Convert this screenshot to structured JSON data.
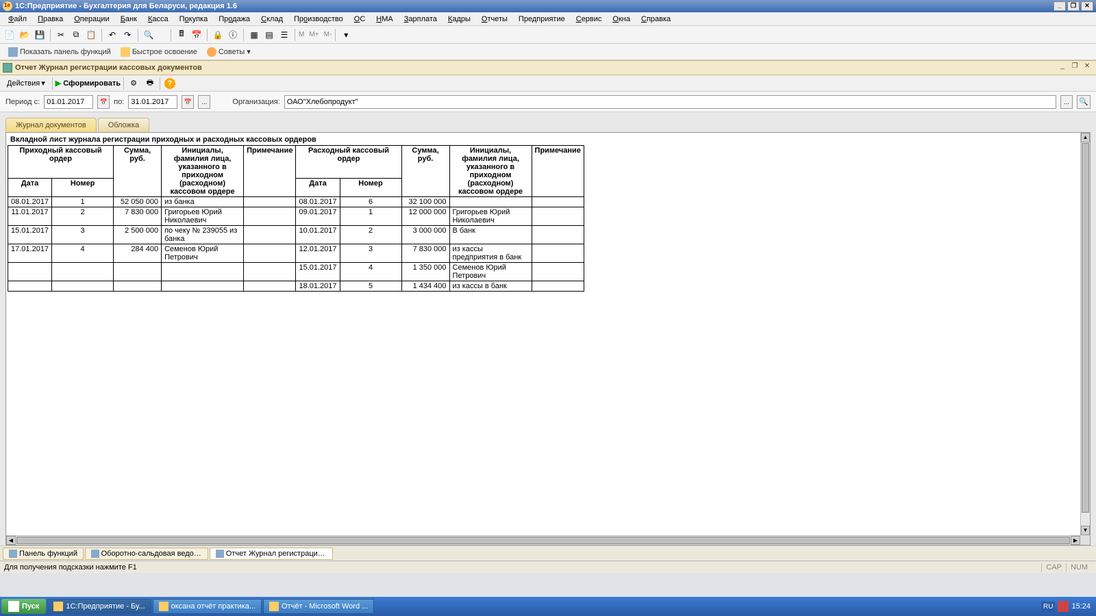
{
  "titlebar": {
    "title": "1С:Предприятие - Бухгалтерия для Беларуси, редакция 1.6"
  },
  "menu": [
    "Файл",
    "Правка",
    "Операции",
    "Банк",
    "Касса",
    "Покупка",
    "Продажа",
    "Склад",
    "Производство",
    "ОС",
    "НМА",
    "Зарплата",
    "Кадры",
    "Отчеты",
    "Предприятие",
    "Сервис",
    "Окна",
    "Справка"
  ],
  "menu_underline_idx": [
    0,
    0,
    0,
    0,
    0,
    1,
    2,
    0,
    2,
    0,
    0,
    0,
    0,
    0,
    3,
    0,
    0,
    0
  ],
  "toolbar_m": [
    "М",
    "М+",
    "М-"
  ],
  "toolbar2": {
    "panel": "Показать панель функций",
    "quick": "Быстрое освоение",
    "tips": "Советы"
  },
  "doc": {
    "title": "Отчет Журнал регистрации кассовых документов"
  },
  "actions": {
    "actions": "Действия",
    "generate": "Сформировать"
  },
  "filter": {
    "period_label": "Период с:",
    "from": "01.01.2017",
    "to_label": "по:",
    "to": "31.01.2017",
    "org_label": "Организация:",
    "org": "ОАО\"Хлебопродукт\""
  },
  "tabs": [
    "Журнал документов",
    "Обложка"
  ],
  "report": {
    "title": "Вкладной лист журнала регистрации приходных и расходных кассовых ордеров",
    "headers": {
      "pko": "Приходный кассовый ордер",
      "rko": "Расходный кассовый ордер",
      "date": "Дата",
      "num": "Номер",
      "sum": "Сумма, руб.",
      "person": "Инициалы, фамилия лица, указанного в приходном (расходном) кассовом ордере",
      "note": "Примечание"
    },
    "rows": [
      {
        "pd": "08.01.2017",
        "pn": "1",
        "ps": "52 050 000",
        "pp": "из банка",
        "pnote": "",
        "rd": "08.01.2017",
        "rn": "6",
        "rs": "32 100 000",
        "rp": "",
        "rnote": ""
      },
      {
        "pd": "11.01.2017",
        "pn": "2",
        "ps": "7 830 000",
        "pp": "Григорьев Юрий Николаевич",
        "pnote": "",
        "rd": "09.01.2017",
        "rn": "1",
        "rs": "12 000 000",
        "rp": "Григорьев Юрий Николаевич",
        "rnote": ""
      },
      {
        "pd": "15.01.2017",
        "pn": "3",
        "ps": "2 500 000",
        "pp": "по чеку № 239055 из банка",
        "pnote": "",
        "rd": "10.01.2017",
        "rn": "2",
        "rs": "3 000 000",
        "rp": "В банк",
        "rnote": ""
      },
      {
        "pd": "17.01.2017",
        "pn": "4",
        "ps": "284 400",
        "pp": "Семенов Юрий Петрович",
        "pnote": "",
        "rd": "12.01.2017",
        "rn": "3",
        "rs": "7 830 000",
        "rp": "из кассы предприятия в банк",
        "rnote": ""
      },
      {
        "pd": "",
        "pn": "",
        "ps": "",
        "pp": "",
        "pnote": "",
        "rd": "15.01.2017",
        "rn": "4",
        "rs": "1 350 000",
        "rp": "Семенов Юрий Петрович",
        "rnote": ""
      },
      {
        "pd": "",
        "pn": "",
        "ps": "",
        "pp": "",
        "pnote": "",
        "rd": "18.01.2017",
        "rn": "5",
        "rs": "1 434 400",
        "rp": "из кассы в банк",
        "rnote": ""
      }
    ]
  },
  "ws_tabs": [
    {
      "label": "Панель функций"
    },
    {
      "label": "Оборотно-сальдовая ведом..."
    },
    {
      "label": "Отчет Журнал регистрации..."
    }
  ],
  "status": {
    "hint": "Для получения подсказки нажмите F1",
    "cap": "CAP",
    "num": "NUM"
  },
  "taskbar": {
    "start": "Пуск",
    "items": [
      "1С:Предприятие - Бу...",
      "оксана отчёт практика...",
      "Отчёт - Microsoft Word ..."
    ],
    "lang": "RU",
    "clock": "15:24"
  }
}
